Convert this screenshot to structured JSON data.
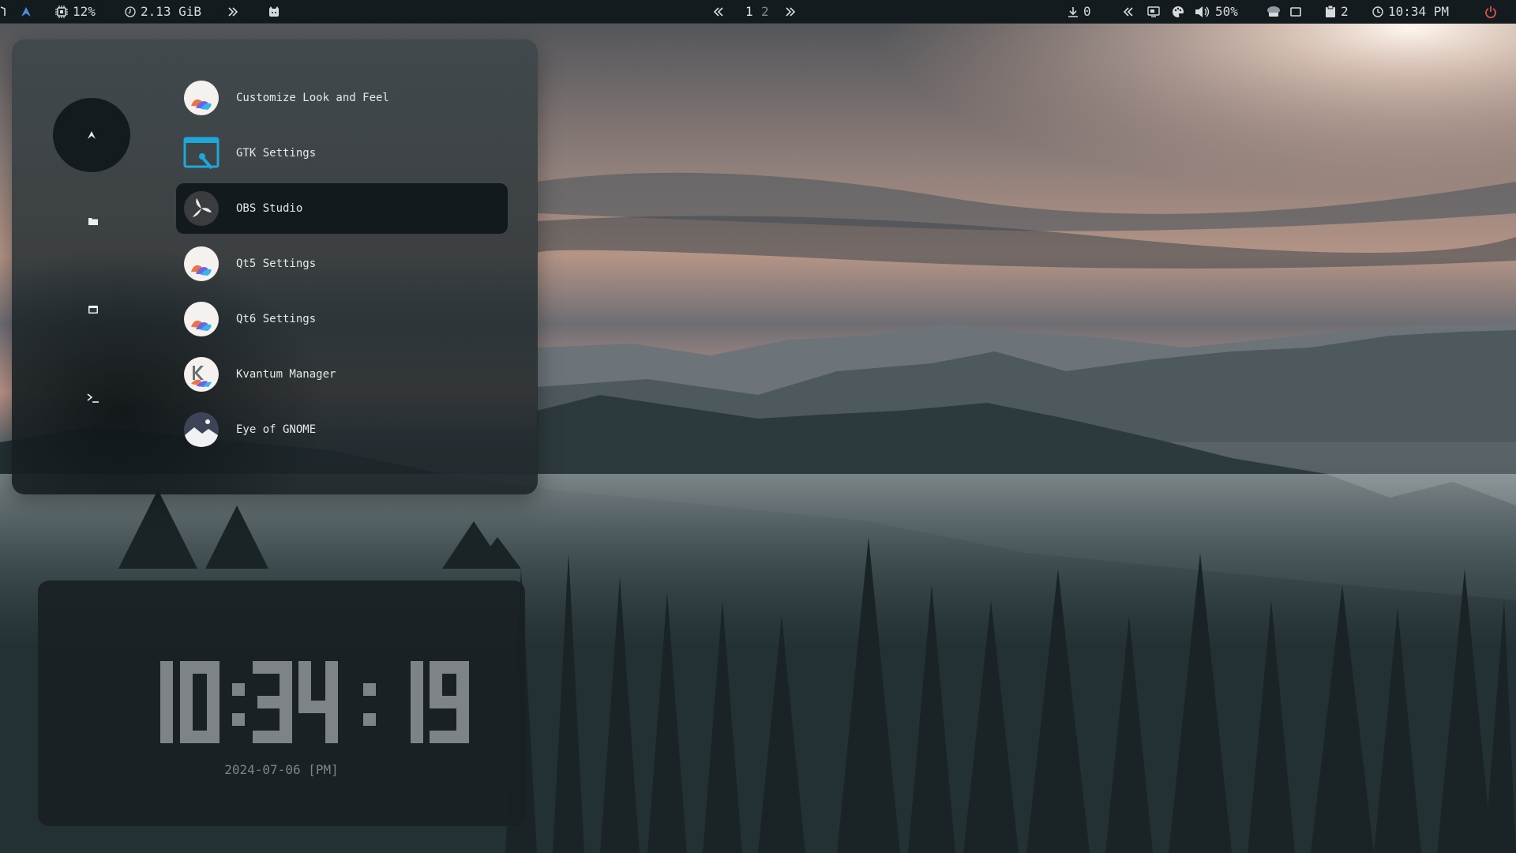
{
  "topbar": {
    "cpu_percent": "12%",
    "memory": "2.13 GiB",
    "workspaces": [
      "1",
      "2"
    ],
    "updates_count": "0",
    "volume_percent": "50%",
    "clipboard_count": "2",
    "time": "10:34 PM"
  },
  "launcher": {
    "apps": [
      {
        "label": "Customize Look and Feel",
        "icon": "look-and-feel-icon"
      },
      {
        "label": "GTK Settings",
        "icon": "gtk-settings-icon"
      },
      {
        "label": "OBS Studio",
        "icon": "obs-studio-icon",
        "selected": true
      },
      {
        "label": "Qt5 Settings",
        "icon": "qt5-settings-icon"
      },
      {
        "label": "Qt6 Settings",
        "icon": "qt6-settings-icon"
      },
      {
        "label": "Kvantum Manager",
        "icon": "kvantum-manager-icon"
      },
      {
        "label": "Eye of GNOME",
        "icon": "eye-of-gnome-icon"
      }
    ]
  },
  "clock_widget": {
    "time": "10:34: 19",
    "date": "2024-07-06 [PM]"
  },
  "colors": {
    "accent_blue": "#4c8ed9",
    "power_red": "#e0524f",
    "bar_bg": "#141b1e"
  }
}
